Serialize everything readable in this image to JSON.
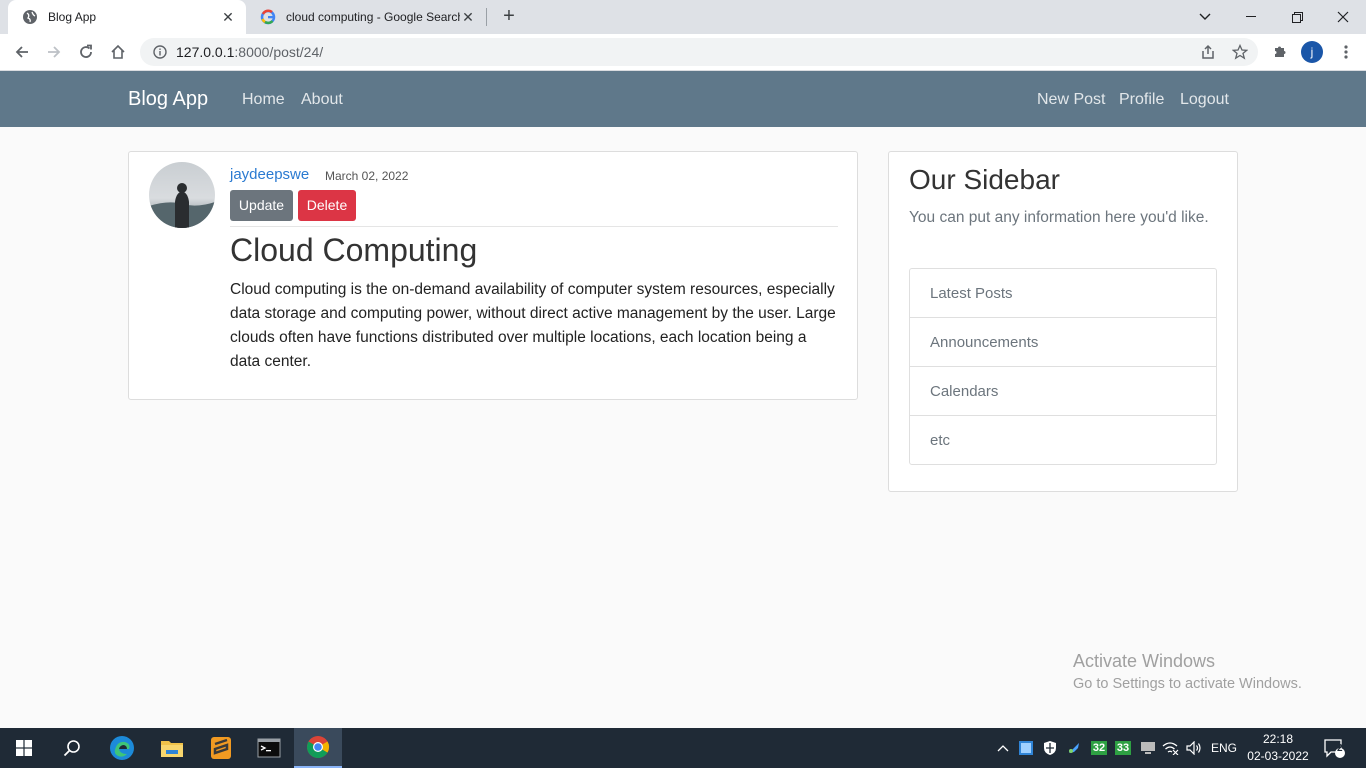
{
  "browser": {
    "tabs": [
      {
        "title": "Blog App",
        "active": true
      },
      {
        "title": "cloud computing - Google Search",
        "active": false
      }
    ],
    "url_host": "127.0.0.1",
    "url_path": ":8000/post/24/",
    "profile_initial": "j"
  },
  "navbar": {
    "brand": "Blog App",
    "left_links": [
      "Home",
      "About"
    ],
    "right_links": [
      "New Post",
      "Profile",
      "Logout"
    ]
  },
  "post": {
    "author": "jaydeepswe",
    "date": "March 02, 2022",
    "update_label": "Update",
    "delete_label": "Delete",
    "title": "Cloud Computing",
    "body": "Cloud computing is the on-demand availability of computer system resources, especially data storage and computing power, without direct active management by the user. Large clouds often have functions distributed over multiple locations, each location being a data center."
  },
  "sidebar": {
    "title": "Our Sidebar",
    "text": "You can put any information here you'd like.",
    "items": [
      "Latest Posts",
      "Announcements",
      "Calendars",
      "etc"
    ]
  },
  "watermark": {
    "line1": "Activate Windows",
    "line2": "Go to Settings to activate Windows."
  },
  "taskbar": {
    "lang": "ENG",
    "time": "22:18",
    "date": "02-03-2022",
    "notification_count": "2",
    "tray_badges": [
      "32",
      "33"
    ]
  },
  "colors": {
    "navbar": "#5f788a",
    "link": "#2a7ad1",
    "update_button": "#6c757d",
    "delete_button": "#dc3545"
  }
}
